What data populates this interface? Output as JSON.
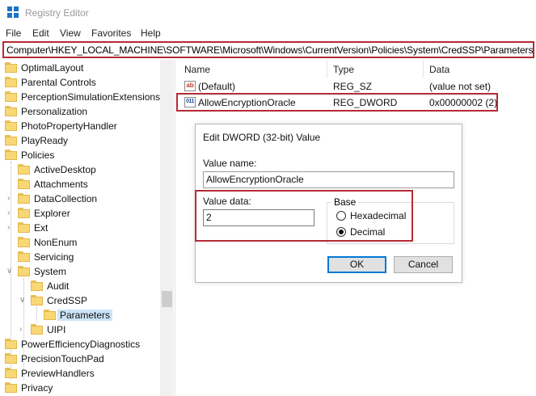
{
  "window": {
    "title": "Registry Editor"
  },
  "menu": [
    "File",
    "Edit",
    "View",
    "Favorites",
    "Help"
  ],
  "address": "Computer\\HKEY_LOCAL_MACHINE\\SOFTWARE\\Microsoft\\Windows\\CurrentVersion\\Policies\\System\\CredSSP\\Parameters",
  "tree": {
    "items": [
      {
        "label": "OptimalLayout",
        "level": 0
      },
      {
        "label": "Parental Controls",
        "level": 0
      },
      {
        "label": "PerceptionSimulationExtensions",
        "level": 0
      },
      {
        "label": "Personalization",
        "level": 0
      },
      {
        "label": "PhotoPropertyHandler",
        "level": 0
      },
      {
        "label": "PlayReady",
        "level": 0
      },
      {
        "label": "Policies",
        "level": 0
      },
      {
        "label": "ActiveDesktop",
        "level": 1
      },
      {
        "label": "Attachments",
        "level": 1
      },
      {
        "label": "DataCollection",
        "level": 1
      },
      {
        "label": "Explorer",
        "level": 1
      },
      {
        "label": "Ext",
        "level": 1
      },
      {
        "label": "NonEnum",
        "level": 1
      },
      {
        "label": "Servicing",
        "level": 1
      },
      {
        "label": "System",
        "level": 1
      },
      {
        "label": "Audit",
        "level": 2
      },
      {
        "label": "CredSSP",
        "level": 2
      },
      {
        "label": "Parameters",
        "level": 3
      },
      {
        "label": "UIPI",
        "level": 2
      },
      {
        "label": "PowerEfficiencyDiagnostics",
        "level": 0
      },
      {
        "label": "PrecisionTouchPad",
        "level": 0
      },
      {
        "label": "PreviewHandlers",
        "level": 0
      },
      {
        "label": "Privacy",
        "level": 0
      }
    ]
  },
  "list": {
    "columns": [
      "Name",
      "Type",
      "Data"
    ],
    "rows": [
      {
        "name": "(Default)",
        "type": "REG_SZ",
        "data": "(value not set)",
        "icon": "string-value-icon"
      },
      {
        "name": "AllowEncryptionOracle",
        "type": "REG_DWORD",
        "data": "0x00000002 (2)",
        "icon": "binary-value-icon"
      }
    ]
  },
  "dialog": {
    "title": "Edit DWORD (32-bit) Value",
    "value_name_label": "Value name:",
    "value_name": "AllowEncryptionOracle",
    "value_data_label": "Value data:",
    "value_data": "2",
    "base_label": "Base",
    "hex_label": "Hexadecimal",
    "dec_label": "Decimal",
    "selected_base": "Decimal",
    "ok_label": "OK",
    "cancel_label": "Cancel"
  },
  "colors": {
    "highlight_border": "#b42b34",
    "folder": "#f8d775",
    "selection": "#cce4f7",
    "default_button": "#0078d7"
  }
}
